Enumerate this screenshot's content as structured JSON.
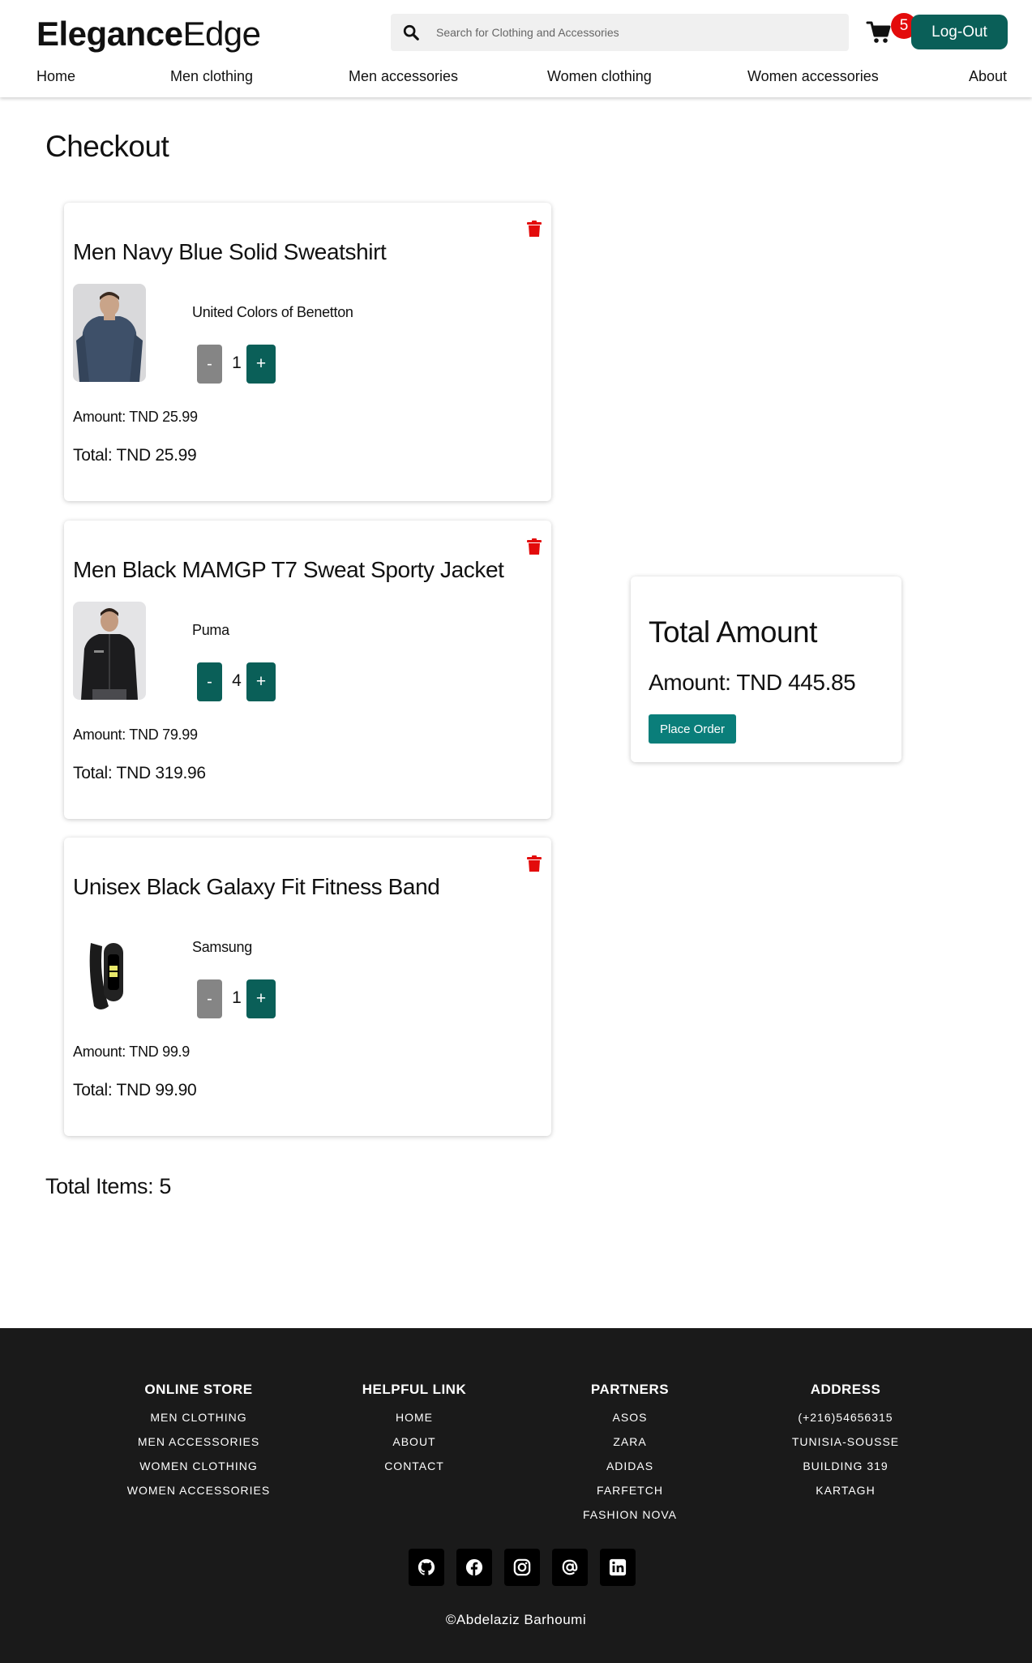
{
  "header": {
    "logo_bold": "Elegance",
    "logo_light": "Edge",
    "search_placeholder": "Search for Clothing and Accessories",
    "cart_count": "5",
    "logout_label": "Log-Out"
  },
  "nav": [
    {
      "label": "Home"
    },
    {
      "label": "Men clothing"
    },
    {
      "label": "Men accessories"
    },
    {
      "label": "Women clothing"
    },
    {
      "label": "Women accessories"
    },
    {
      "label": "About"
    }
  ],
  "page_title": "Checkout",
  "cart_items": [
    {
      "name": "Men Navy Blue Solid Sweatshirt",
      "brand": "United Colors of Benetton",
      "minus": "-",
      "quantity": "1",
      "plus": "+",
      "amount": "Amount: TND 25.99",
      "total": "Total: TND 25.99",
      "minus_color": "#858585"
    },
    {
      "name": "Men Black MAMGP T7 Sweat Sporty Jacket",
      "brand": "Puma",
      "minus": "-",
      "quantity": "4",
      "plus": "+",
      "amount": "Amount: TND 79.99",
      "total": "Total: TND 319.96",
      "minus_color": "#0a5f58"
    },
    {
      "name": "Unisex Black Galaxy Fit Fitness Band",
      "brand": "Samsung",
      "minus": "-",
      "quantity": "1",
      "plus": "+",
      "amount": "Amount: TND 99.9",
      "total": "Total: TND 99.90",
      "minus_color": "#858585"
    }
  ],
  "total_items": "Total Items: 5",
  "summary": {
    "title": "Total Amount",
    "amount": "Amount: TND 445.85",
    "place_order": "Place Order"
  },
  "footer": {
    "columns": [
      {
        "heading": "ONLINE STORE",
        "items": [
          "MEN CLOTHING",
          "MEN ACCESSORIES",
          "WOMEN CLOTHING",
          "WOMEN ACCESSORIES"
        ]
      },
      {
        "heading": "HELPFUL LINK",
        "items": [
          "HOME",
          "ABOUT",
          "CONTACT"
        ]
      },
      {
        "heading": "PARTNERS",
        "items": [
          "ASOS",
          "ZARA",
          "ADIDAS",
          "FARFETCH",
          "FASHION NOVA"
        ]
      },
      {
        "heading": "ADDRESS",
        "items": [
          "(+216)54656315",
          "TUNISIA-SOUSSE",
          "BUILDING 319",
          "KARTAGH"
        ]
      }
    ],
    "socials": [
      "github-icon",
      "facebook-icon",
      "instagram-icon",
      "email-icon",
      "linkedin-icon"
    ],
    "copyright": "©Abdelaziz Barhoumi"
  },
  "colors": {
    "accent": "#0a5f58",
    "badge": "#e30b0b",
    "trash": "#e30b0b",
    "footer_bg": "#1a1a1a"
  }
}
